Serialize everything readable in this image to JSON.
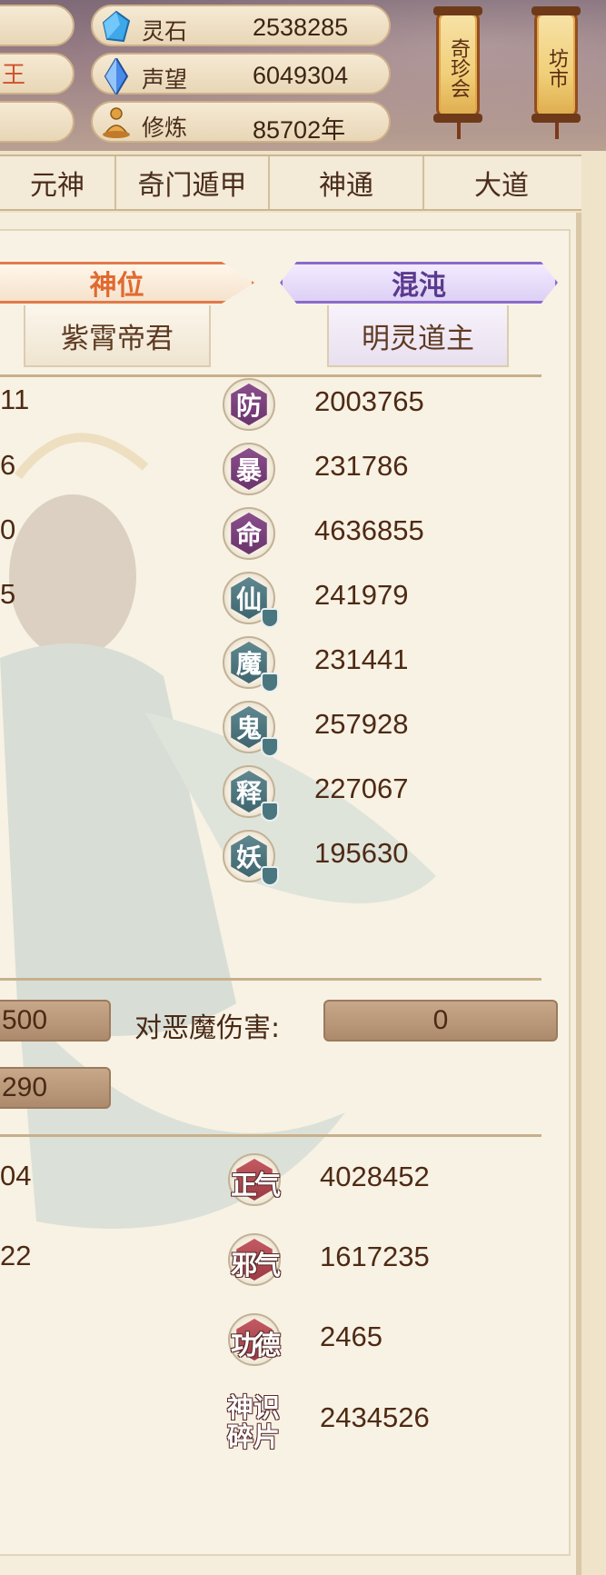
{
  "resources": {
    "side_char": "王",
    "items": [
      {
        "label": "灵石",
        "value": "2538285",
        "icon": "spirit-stone-icon"
      },
      {
        "label": "声望",
        "value": "6049304",
        "icon": "prestige-crystal-icon"
      },
      {
        "label": "修炼",
        "value": "85702年",
        "icon": "meditation-icon"
      }
    ]
  },
  "lanterns": [
    {
      "label": "奇珍会"
    },
    {
      "label": "坊市"
    }
  ],
  "tabs": [
    "元神",
    "奇门遁甲",
    "神通",
    "大道"
  ],
  "badges": {
    "shenwei": {
      "title": "神位",
      "name": "紫霄帝君"
    },
    "hundun": {
      "title": "混沌",
      "name": "明灵道主"
    }
  },
  "left_cut_values": [
    "11",
    "6",
    "0",
    "5"
  ],
  "stats": [
    {
      "char": "防",
      "value": "2003765",
      "color": "purple"
    },
    {
      "char": "暴",
      "value": "231786",
      "color": "purple"
    },
    {
      "char": "命",
      "value": "4636855",
      "color": "purple"
    },
    {
      "char": "仙",
      "value": "241979",
      "color": "teal"
    },
    {
      "char": "魔",
      "value": "231441",
      "color": "teal"
    },
    {
      "char": "鬼",
      "value": "257928",
      "color": "teal"
    },
    {
      "char": "释",
      "value": "227067",
      "color": "teal"
    },
    {
      "char": "妖",
      "value": "195630",
      "color": "teal"
    }
  ],
  "damage": {
    "left_box_1": "500",
    "left_box_2": "290",
    "demon_label": "对恶魔伤害:",
    "demon_value": "0"
  },
  "left_cut_bottom": [
    "04",
    "22"
  ],
  "morals": [
    {
      "label": "正气",
      "value": "4028452"
    },
    {
      "label": "邪气",
      "value": "1617235"
    },
    {
      "label": "功德",
      "value": "2465"
    },
    {
      "label": "神识碎片",
      "label_line1": "神识",
      "label_line2": "碎片",
      "value": "2434526"
    }
  ],
  "colors": {
    "accent_orange": "#e06a30",
    "accent_purple": "#5a3a8e",
    "stat_purple": "#7a4080",
    "stat_teal": "#4f7880",
    "stat_red": "#b04a54"
  }
}
